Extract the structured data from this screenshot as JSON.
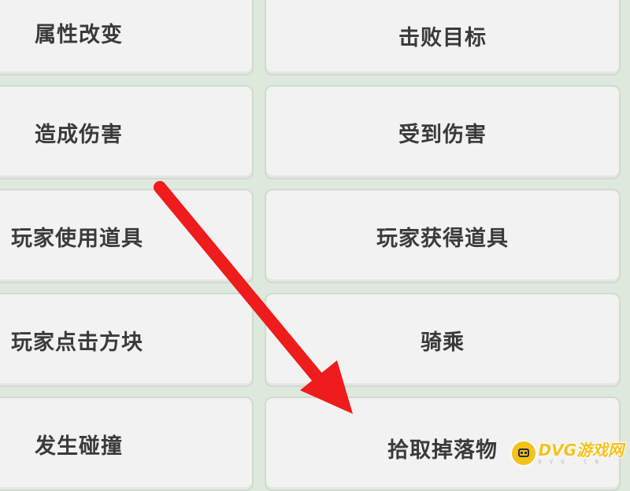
{
  "buttons": {
    "attribute_change": "属性改变",
    "defeat_target": "击败目标",
    "deal_damage": "造成伤害",
    "receive_damage": "受到伤害",
    "player_use_item": "玩家使用道具",
    "player_obtain_item": "玩家获得道具",
    "player_click_block": "玩家点击方块",
    "ride": "骑乘",
    "collision_occurs": "发生碰撞",
    "pick_up_drop": "拾取掉落物"
  },
  "annotation": {
    "arrow_color": "#ee1c1c"
  },
  "watermark": {
    "main": "DVG游戏网",
    "sub": "D V G . C N"
  },
  "colors": {
    "background": "#dde9dc",
    "button": "#f2f2f2",
    "text": "#3a3a3a",
    "watermark": "#f4c21b"
  }
}
